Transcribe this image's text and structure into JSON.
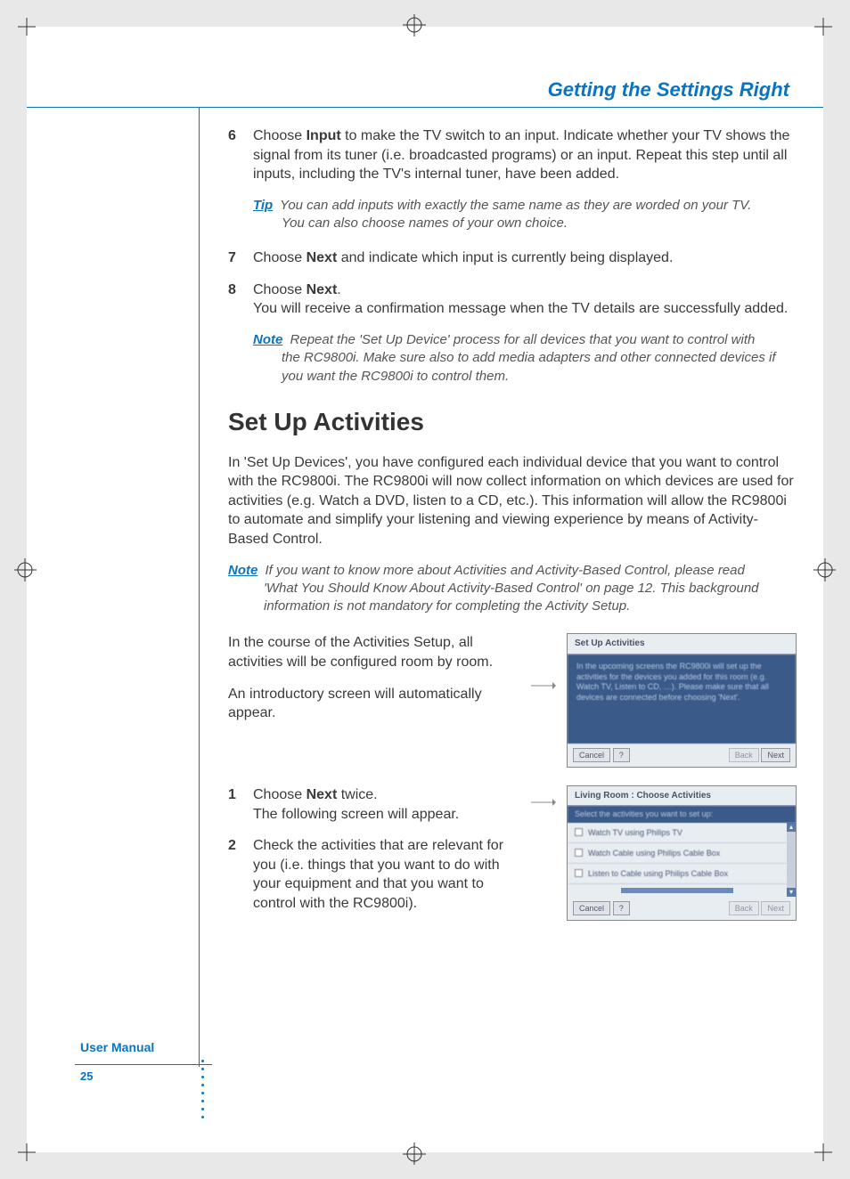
{
  "header": {
    "title": "Getting the Settings Right"
  },
  "steps_a": {
    "s6": {
      "num": "6",
      "text_pre": "Choose ",
      "bold": "Input",
      "text_post": " to make the TV switch to an input. Indicate whether your TV shows the signal from its tuner (i.e. broadcasted programs) or an input. Repeat this step until all inputs, including the TV's internal tuner, have been added."
    },
    "tip": {
      "label": "Tip",
      "line1": "You can add inputs with exactly the same name as they are worded on your TV.",
      "line2": "You can also choose names of your own choice."
    },
    "s7": {
      "num": "7",
      "text_pre": "Choose ",
      "bold": "Next",
      "text_post": " and indicate which input is currently being displayed."
    },
    "s8": {
      "num": "8",
      "text_pre": "Choose ",
      "bold": "Next",
      "text_post": ".",
      "extra": "You will receive a confirmation message when the TV details are successfully added."
    },
    "note": {
      "label": "Note",
      "line1": "Repeat the 'Set Up Device' process for all devices that you want to control with",
      "line2": "the RC9800i. Make sure also to add media adapters and other connected devices if",
      "line3": "you want the RC9800i to control them."
    }
  },
  "section": {
    "heading": "Set Up Activities",
    "para": "In 'Set Up Devices', you have configured each individual device that you want to control with the RC9800i. The RC9800i will now collect information on which devices are used for activities (e.g. Watch a DVD, listen to a CD, etc.). This information will allow the RC9800i to automate and simplify your listening and viewing experience by means of Activity-Based Control.",
    "note": {
      "label": "Note",
      "line1": "If you want to know more about Activities and Activity-Based Control, please read",
      "line2": "'What You Should Know About Activity-Based Control' on page 12. This background",
      "line3": "information is not mandatory for completing the Activity Setup."
    },
    "intro1": "In the course of the Activities Setup, all activities will be configured room by room.",
    "intro2": "An introductory screen will automatically appear."
  },
  "screenshot1": {
    "title": "Set Up Activities",
    "body": "In the upcoming screens the RC9800i will set up the activities for the devices you added for this room (e.g. Watch TV, Listen to CD, …). Please make sure that all devices are connected before choosing 'Next'.",
    "cancel": "Cancel",
    "help": "?",
    "back": "Back",
    "next": "Next"
  },
  "steps_b": {
    "s1": {
      "num": "1",
      "pre": "Choose ",
      "bold": "Next",
      "post": " twice.",
      "extra": "The following screen will appear."
    },
    "s2": {
      "num": "2",
      "text": "Check the activities that are relevant for you (i.e. things that you want to do with your equipment and that you want to control with the RC9800i)."
    }
  },
  "screenshot2": {
    "title": "Living Room : Choose Activities",
    "subtitle": "Select the activities you want to set up:",
    "items": [
      "Watch TV using Philips TV",
      "Watch Cable using Philips Cable Box",
      "Listen to Cable using Philips Cable Box"
    ],
    "cancel": "Cancel",
    "help": "?",
    "back": "Back",
    "next": "Next"
  },
  "footer": {
    "label": "User Manual",
    "page": "25"
  }
}
